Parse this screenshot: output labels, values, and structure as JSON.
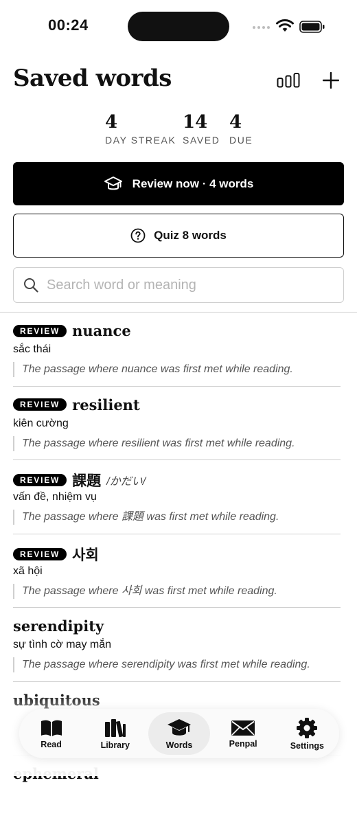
{
  "status_bar": {
    "time": "00:24"
  },
  "header": {
    "title": "Saved words"
  },
  "stats": [
    {
      "value": "4",
      "label": "DAY STREAK"
    },
    {
      "value": "14",
      "label": "SAVED"
    },
    {
      "value": "4",
      "label": "DUE"
    }
  ],
  "actions": {
    "review_label": "Review now · 4 words",
    "quiz_label": "Quiz 8 words"
  },
  "search": {
    "placeholder": "Search word or meaning",
    "value": ""
  },
  "words": [
    {
      "badge": "REVIEW",
      "term": "nuance",
      "reading": "",
      "meaning": "sắc thái",
      "passage": "The passage where nuance was first met while reading."
    },
    {
      "badge": "REVIEW",
      "term": "resilient",
      "reading": "",
      "meaning": "kiên cường",
      "passage": "The passage where resilient was first met while reading."
    },
    {
      "badge": "REVIEW",
      "term": "課題",
      "reading": "/かだい/",
      "meaning": "vấn đề, nhiệm vụ",
      "passage": "The passage where 課題 was first met while reading."
    },
    {
      "badge": "REVIEW",
      "term": "사회",
      "reading": "",
      "meaning": "xã hội",
      "passage": "The passage where 사회 was first met while reading."
    },
    {
      "badge": "",
      "term": "serendipity",
      "reading": "",
      "meaning": "sự tình cờ may mắn",
      "passage": "The passage where serendipity was first met while reading."
    },
    {
      "badge": "",
      "term": "ubiquitous",
      "reading": "",
      "meaning": "",
      "passage": ""
    },
    {
      "badge": "",
      "term": "ephemeral",
      "reading": "",
      "meaning": "",
      "passage": ""
    }
  ],
  "tabs": [
    {
      "label": "Read",
      "icon": "book-icon",
      "active": false
    },
    {
      "label": "Library",
      "icon": "library-icon",
      "active": false
    },
    {
      "label": "Words",
      "icon": "graduation-cap-icon",
      "active": true
    },
    {
      "label": "Penpal",
      "icon": "envelope-icon",
      "active": false
    },
    {
      "label": "Settings",
      "icon": "gear-icon",
      "active": false
    }
  ]
}
